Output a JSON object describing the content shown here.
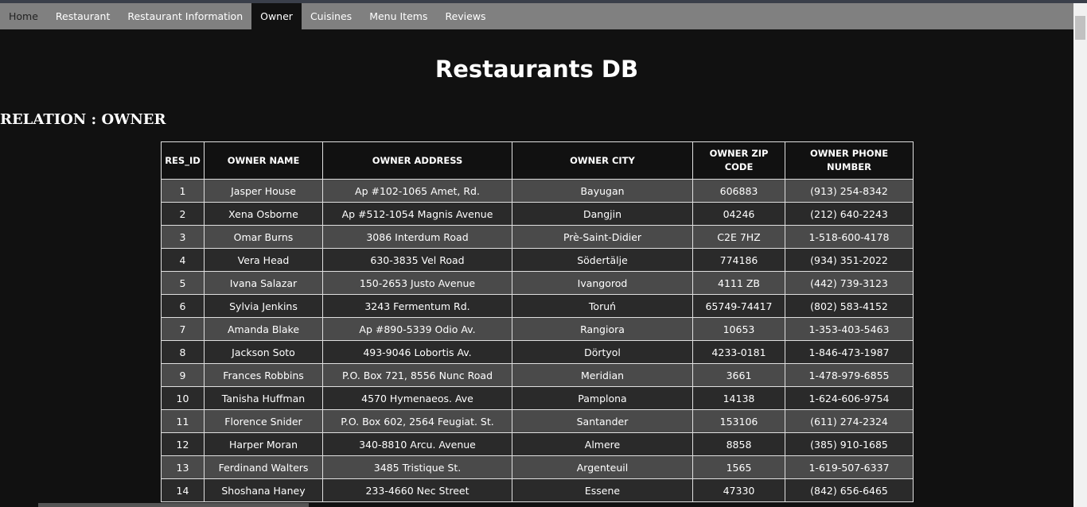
{
  "nav": {
    "items": [
      {
        "label": "Home",
        "active": false
      },
      {
        "label": "Restaurant",
        "active": false
      },
      {
        "label": "Restaurant Information",
        "active": false
      },
      {
        "label": "Owner",
        "active": true
      },
      {
        "label": "Cuisines",
        "active": false
      },
      {
        "label": "Menu Items",
        "active": false
      },
      {
        "label": "Reviews",
        "active": false
      }
    ]
  },
  "page": {
    "title": "Restaurants DB",
    "relation": "RELATION : OWNER"
  },
  "table": {
    "headers": [
      "RES_ID",
      "OWNER NAME",
      "OWNER ADDRESS",
      "OWNER CITY",
      "OWNER ZIP CODE",
      "OWNER PHONE NUMBER"
    ],
    "rows": [
      [
        "1",
        "Jasper House",
        "Ap #102-1065 Amet, Rd.",
        "Bayugan",
        "606883",
        "(913) 254-8342"
      ],
      [
        "2",
        "Xena Osborne",
        "Ap #512-1054 Magnis Avenue",
        "Dangjin",
        "04246",
        "(212) 640-2243"
      ],
      [
        "3",
        "Omar Burns",
        "3086 Interdum Road",
        "Prè-Saint-Didier",
        "C2E 7HZ",
        "1-518-600-4178"
      ],
      [
        "4",
        "Vera Head",
        "630-3835 Vel Road",
        "Södertälje",
        "774186",
        "(934) 351-2022"
      ],
      [
        "5",
        "Ivana Salazar",
        "150-2653 Justo Avenue",
        "Ivangorod",
        "4111 ZB",
        "(442) 739-3123"
      ],
      [
        "6",
        "Sylvia Jenkins",
        "3243 Fermentum Rd.",
        "Toruń",
        "65749-74417",
        "(802) 583-4152"
      ],
      [
        "7",
        "Amanda Blake",
        "Ap #890-5339 Odio Av.",
        "Rangiora",
        "10653",
        "1-353-403-5463"
      ],
      [
        "8",
        "Jackson Soto",
        "493-9046 Lobortis Av.",
        "Dörtyol",
        "4233-0181",
        "1-846-473-1987"
      ],
      [
        "9",
        "Frances Robbins",
        "P.O. Box 721, 8556 Nunc Road",
        "Meridian",
        "3661",
        "1-478-979-6855"
      ],
      [
        "10",
        "Tanisha Huffman",
        "4570 Hymenaeos. Ave",
        "Pamplona",
        "14138",
        "1-624-606-9754"
      ],
      [
        "11",
        "Florence Snider",
        "P.O. Box 602, 2564 Feugiat. St.",
        "Santander",
        "153106",
        "(611) 274-2324"
      ],
      [
        "12",
        "Harper Moran",
        "340-8810 Arcu. Avenue",
        "Almere",
        "8858",
        "(385) 910-1685"
      ],
      [
        "13",
        "Ferdinand Walters",
        "3485 Tristique St.",
        "Argenteuil",
        "1565",
        "1-619-507-6337"
      ],
      [
        "14",
        "Shoshana Haney",
        "233-4660 Nec Street",
        "Essene",
        "47330",
        "(842) 656-6465"
      ]
    ]
  }
}
